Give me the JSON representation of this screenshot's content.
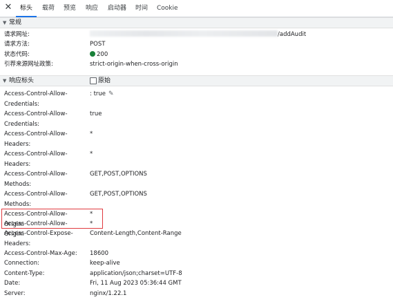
{
  "tabs": [
    "标头",
    "载荷",
    "预览",
    "响应",
    "启动器",
    "时间",
    "Cookie"
  ],
  "general": {
    "title": "常规",
    "rows": [
      {
        "name": "请求网址:",
        "value": "/addAudit"
      },
      {
        "name": "请求方法:",
        "value": "POST"
      },
      {
        "name": "状态代码:",
        "value": "200"
      },
      {
        "name": "引荐来源网址政策:",
        "value": "strict-origin-when-cross-origin"
      }
    ]
  },
  "response": {
    "title": "响应标头",
    "raw_label": "原始",
    "rows": [
      {
        "name": "Access-Control-Allow-\nCredentials:",
        "value": ": true"
      },
      {
        "name": "Access-Control-Allow-\nCredentials:",
        "value": "true"
      },
      {
        "name": "Access-Control-Allow-\nHeaders:",
        "value": "*"
      },
      {
        "name": "Access-Control-Allow-\nHeaders:",
        "value": "*"
      },
      {
        "name": "Access-Control-Allow-\nMethods:",
        "value": "GET,POST,OPTIONS"
      },
      {
        "name": "Access-Control-Allow-\nMethods:",
        "value": "GET,POST,OPTIONS"
      },
      {
        "name": "Access-Control-Allow-Origin:",
        "value": "*"
      },
      {
        "name": "Access-Control-Allow-Origin:",
        "value": "*"
      },
      {
        "name": "Access-Control-Expose-\nHeaders:",
        "value": "Content-Length,Content-Range"
      },
      {
        "name": "Access-Control-Max-Age:",
        "value": "18600"
      },
      {
        "name": "Connection:",
        "value": "keep-alive"
      },
      {
        "name": "Content-Type:",
        "value": "application/json;charset=UTF-8"
      },
      {
        "name": "Date:",
        "value": "Fri, 11 Aug 2023 05:36:44 GMT"
      },
      {
        "name": "Server:",
        "value": "nginx/1.22.1"
      }
    ]
  },
  "colors": {
    "accent": "#1a73e8",
    "status_ok": "#188038",
    "highlight": "#e0393e"
  },
  "icons": {
    "close": "close-icon",
    "edit": "pencil-icon",
    "collapse": "caret-down-icon"
  }
}
